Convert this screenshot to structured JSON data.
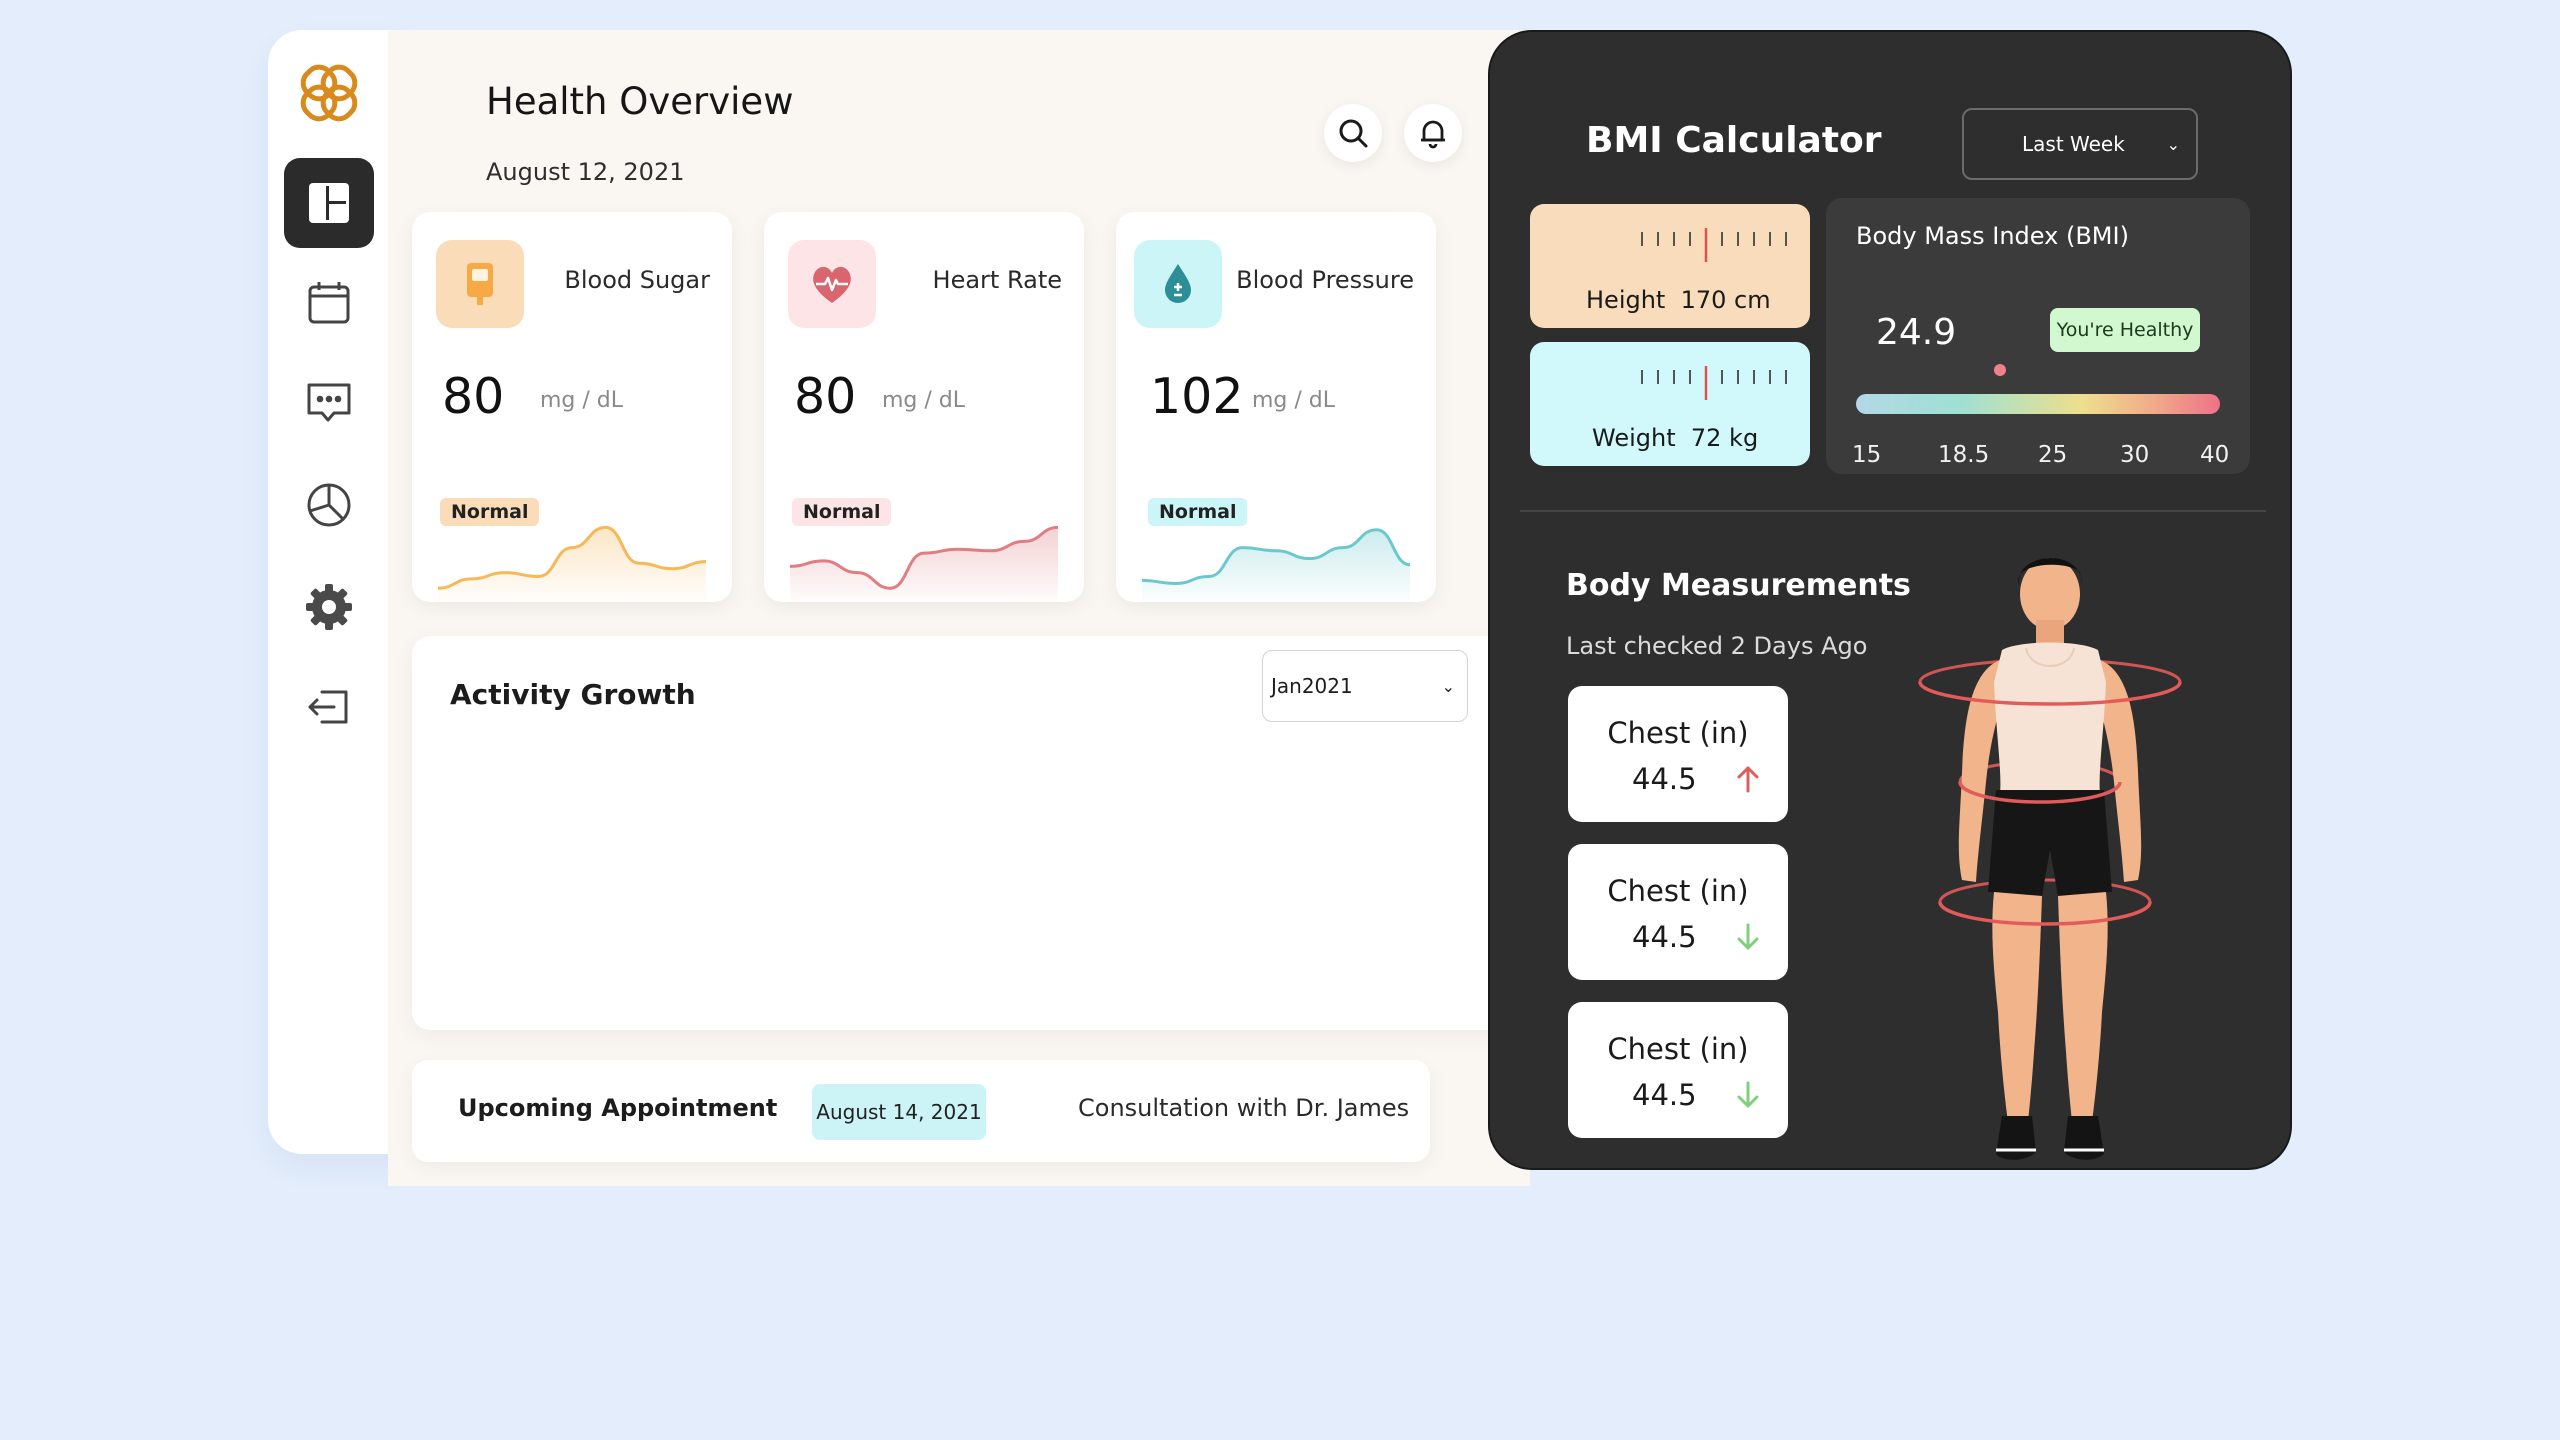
{
  "header": {
    "title": "Health Overview",
    "date": "August 12, 2021"
  },
  "sidebar": {
    "items": [
      {
        "name": "dashboard",
        "icon": "dashboard-icon",
        "active": true
      },
      {
        "name": "calendar",
        "icon": "calendar-icon"
      },
      {
        "name": "messages",
        "icon": "message-icon"
      },
      {
        "name": "reports",
        "icon": "pie-chart-icon"
      },
      {
        "name": "settings",
        "icon": "gear-icon"
      },
      {
        "name": "logout",
        "icon": "logout-icon"
      }
    ]
  },
  "vitals": [
    {
      "label": "Blood Sugar",
      "value": "80",
      "unit": "mg / dL",
      "status": "Normal",
      "icon": "glucose-meter-icon",
      "accent": "#f6b858",
      "icon_bg": "#fbdcb8",
      "badge_bg": "#fbdcb8",
      "trend": [
        0.1,
        0.22,
        0.3,
        0.25,
        0.62,
        0.88,
        0.42,
        0.35,
        0.44
      ]
    },
    {
      "label": "Heart Rate",
      "value": "80",
      "unit": "mg / dL",
      "status": "Normal",
      "icon": "heart-icon",
      "accent": "#e07c82",
      "icon_bg": "#fde4e6",
      "badge_bg": "#fde4e6",
      "trend": [
        0.38,
        0.45,
        0.3,
        0.1,
        0.55,
        0.6,
        0.58,
        0.7,
        0.88
      ]
    },
    {
      "label": "Blood Pressure",
      "value": "102",
      "unit": "mg / dL",
      "status": "Normal",
      "icon": "water-drop-icon",
      "accent": "#6cc8cf",
      "icon_bg": "#ccf5f8",
      "badge_bg": "#ccf5f8",
      "trend": [
        0.2,
        0.16,
        0.25,
        0.62,
        0.58,
        0.48,
        0.62,
        0.85,
        0.4
      ]
    }
  ],
  "activity": {
    "title": "Activity Growth",
    "period": "Jan2021"
  },
  "appointment": {
    "title": "Upcoming Appointment",
    "date": "August 14, 2021",
    "description": "Consultation with Dr. James"
  },
  "bmi": {
    "title": "BMI Calculator",
    "range": "Last Week",
    "height_label": "Height",
    "height_value": "170 cm",
    "weight_label": "Weight",
    "weight_value": "72 kg",
    "index_label": "Body Mass Index (BMI)",
    "value": "24.9",
    "value_numeric": 24.9,
    "status": "You're Healthy",
    "scale": [
      "15",
      "18.5",
      "25",
      "30",
      "40"
    ],
    "scale_min": 15,
    "scale_max": 40,
    "height_color": "#f8dcbb",
    "weight_color": "#d1f9fb"
  },
  "measurements": {
    "title": "Body Measurements",
    "last_checked": "Last checked 2 Days Ago",
    "items": [
      {
        "label": "Chest (in)",
        "value": "44.5",
        "direction": "up",
        "arrow_color": "#e05b5b"
      },
      {
        "label": "Chest (in)",
        "value": "44.5",
        "direction": "down",
        "arrow_color": "#7fd07a"
      },
      {
        "label": "Chest (in)",
        "value": "44.5",
        "direction": "down",
        "arrow_color": "#7fd07a"
      }
    ]
  }
}
